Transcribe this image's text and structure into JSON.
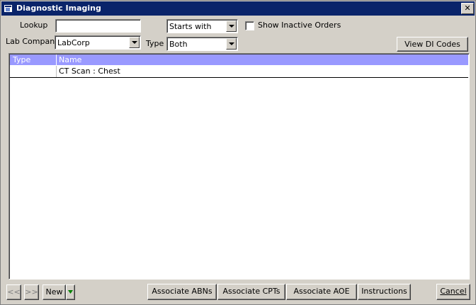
{
  "window": {
    "title": "Diagnostic Imaging",
    "close_glyph": "✕"
  },
  "filters": {
    "lookup_label": "Lookup",
    "lookup_value": "",
    "match_mode_value": "Starts with",
    "show_inactive_label": "Show Inactive Orders",
    "show_inactive_checked": false,
    "lab_company_label": "Lab Company",
    "lab_company_value": "LabCorp",
    "type_label": "Type",
    "type_value": "Both",
    "view_di_codes_label": "View DI Codes"
  },
  "grid": {
    "columns": [
      "Type",
      "Name"
    ],
    "header_color": "#9999ff",
    "rows": [
      {
        "type": "",
        "name": "CT Scan : Chest"
      }
    ]
  },
  "footer": {
    "prev_label": "<<",
    "next_label": ">>",
    "new_label": "New",
    "associate_abns_label": "Associate ABNs",
    "associate_cpts_label": "Associate CPTs",
    "associate_aoe_label": "Associate AOE",
    "instructions_label": "Instructions",
    "cancel_label": "Cancel"
  },
  "colors": {
    "title_bar": "#0a246a",
    "window_bg": "#d4d0c8"
  }
}
